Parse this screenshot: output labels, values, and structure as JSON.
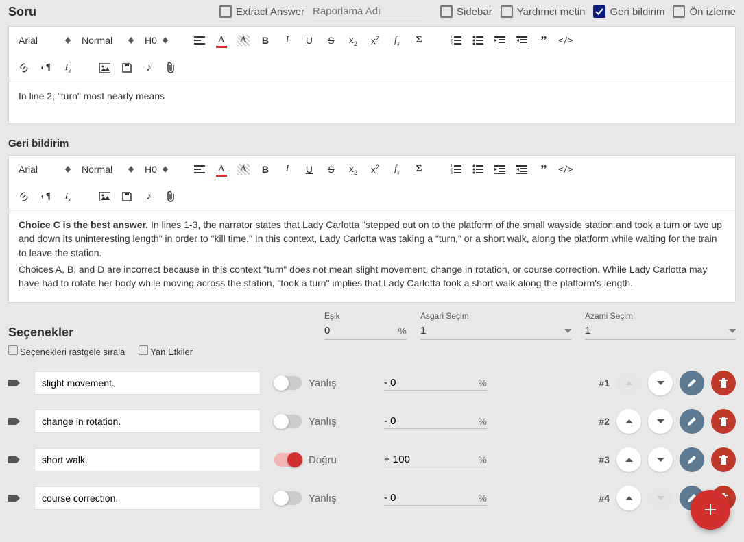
{
  "header": {
    "title": "Soru",
    "extract_answer_label": "Extract Answer",
    "reporting_name_placeholder": "Raporlama Adı",
    "sidebar_label": "Sidebar",
    "helper_text_label": "Yardımcı metin",
    "feedback_label": "Geri bildirim",
    "feedback_checked": true,
    "preview_label": "Ön izleme"
  },
  "toolbar": {
    "font": "Arial",
    "weight": "Normal",
    "heading": "H0"
  },
  "question_body": "In line 2, \"turn\" most nearly means",
  "feedback_title": "Geri bildirim",
  "feedback_body_strong": "Choice C is the best answer.",
  "feedback_body_rest": " In lines 1-3, the narrator states that Lady Carlotta \"stepped out on to the platform of the small wayside station and took a turn or two up and down its uninteresting length\" in order to \"kill time.\" In this context, Lady Carlotta was taking a \"turn,\" or a short walk, along the platform while waiting for the train to leave the station.",
  "feedback_body_p2": "Choices A, B, and D are incorrect because in this context \"turn\" does not mean slight movement, change in rotation, or course correction. While Lady Carlotta may have had to rotate her body while moving across the station, \"took a turn\" implies that Lady Carlotta took a short walk along the platform's length.",
  "options_section": {
    "title": "Seçenekler",
    "threshold_label": "Eşik",
    "threshold_value": "0",
    "min_label": "Asgari Seçim",
    "min_value": "1",
    "max_label": "Azami Seçim",
    "max_value": "1",
    "randomize_label": "Seçenekleri rastgele sırala",
    "side_effects_label": "Yan Etkiler"
  },
  "toggle_labels": {
    "true": "Doğru",
    "false": "Yanlış"
  },
  "options": [
    {
      "text": "slight movement.",
      "correct": false,
      "score": "- 0",
      "rank": "#1",
      "up_disabled": true,
      "down_disabled": false
    },
    {
      "text": "change in rotation.",
      "correct": false,
      "score": "- 0",
      "rank": "#2",
      "up_disabled": false,
      "down_disabled": false
    },
    {
      "text": "short walk.",
      "correct": true,
      "score": "+ 100",
      "rank": "#3",
      "up_disabled": false,
      "down_disabled": false
    },
    {
      "text": "course correction.",
      "correct": false,
      "score": "- 0",
      "rank": "#4",
      "up_disabled": false,
      "down_disabled": true
    }
  ]
}
